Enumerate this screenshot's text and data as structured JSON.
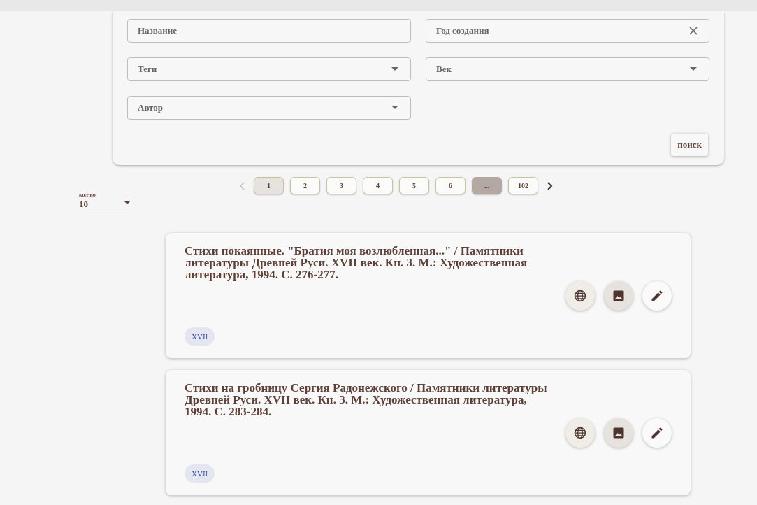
{
  "filters": [
    {
      "kind": "text",
      "placeholder": "Название",
      "clearable": false
    },
    {
      "kind": "text",
      "placeholder": "Год создания",
      "clearable": true
    },
    {
      "kind": "select",
      "placeholder": "Теги",
      "clearable": false
    },
    {
      "kind": "select",
      "placeholder": "Век",
      "clearable": false
    },
    {
      "kind": "select",
      "placeholder": "Автор",
      "clearable": false
    }
  ],
  "search_button": "поиск",
  "pagination": {
    "prev_disabled": true,
    "next_disabled": false,
    "pages": [
      {
        "label": "1",
        "kind": "page",
        "selected": true
      },
      {
        "label": "2",
        "kind": "page",
        "selected": false
      },
      {
        "label": "3",
        "kind": "page",
        "selected": false
      },
      {
        "label": "4",
        "kind": "page",
        "selected": false
      },
      {
        "label": "5",
        "kind": "page",
        "selected": false
      },
      {
        "label": "6",
        "kind": "page",
        "selected": false
      },
      {
        "label": "...",
        "kind": "ellipsis",
        "selected": false
      },
      {
        "label": "102",
        "kind": "page",
        "selected": false
      }
    ]
  },
  "page_size": {
    "label": "кол-во",
    "value": "10"
  },
  "results": [
    {
      "title": "Стихи покаянные. \"Братия моя возлюбленная...\" / Памятники литературы Древней Руси. XVII век. Кн. 3. М.: Художественная литература, 1994. С. 276-277.",
      "tags": [
        "XVII"
      ],
      "actions": [
        {
          "kind": "globe"
        },
        {
          "kind": "image"
        },
        {
          "kind": "edit"
        }
      ]
    },
    {
      "title": "Стихи на гробницу Сергия Радонежского / Памятники литературы Древней Руси. XVII век. Кн. 3. М.: Художественная литература, 1994. С. 283-284.",
      "tags": [
        "XVII"
      ],
      "actions": [
        {
          "kind": "globe"
        },
        {
          "kind": "image"
        },
        {
          "kind": "edit"
        }
      ]
    }
  ]
}
